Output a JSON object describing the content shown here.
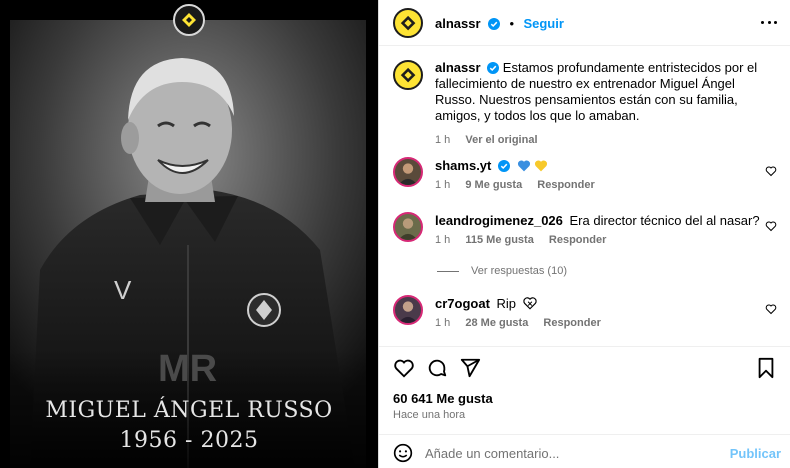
{
  "post_image": {
    "name_line": "MIGUEL ÁNGEL RUSSO",
    "years_line": "1956 - 2025",
    "jacket_letters": "MR",
    "jacket_v": "V"
  },
  "header": {
    "username": "alnassr",
    "separator": "•",
    "follow_label": "Seguir"
  },
  "caption": {
    "username": "alnassr",
    "text": "Estamos profundamente entristecidos por el fallecimiento de nuestro ex entrenador Miguel Ángel Russo. Nuestros pensamientos están con su familia, amigos, y todos los que lo amaban.",
    "time": "1 h",
    "see_original": "Ver el original"
  },
  "comments": [
    {
      "username": "shams.yt",
      "text": "",
      "time": "1 h",
      "likes": "9 Me gusta",
      "reply": "Responder"
    },
    {
      "username": "leandrogimenez_026",
      "text": "Era director técnico del al nasar?",
      "time": "1 h",
      "likes": "115 Me gusta",
      "reply": "Responder"
    },
    {
      "username": "cr7ogoat",
      "text": "Rip",
      "time": "1 h",
      "likes": "28 Me gusta",
      "reply": "Responder"
    }
  ],
  "view_replies": "Ver respuestas (10)",
  "stats": {
    "likes": "60 641 Me gusta",
    "posted": "Hace una hora"
  },
  "composer": {
    "placeholder": "Añade un comentario...",
    "post_label": "Publicar"
  },
  "colors": {
    "accent": "#0095f6",
    "nassr_yellow": "#fde334",
    "verified_blue": "#0095f6"
  }
}
